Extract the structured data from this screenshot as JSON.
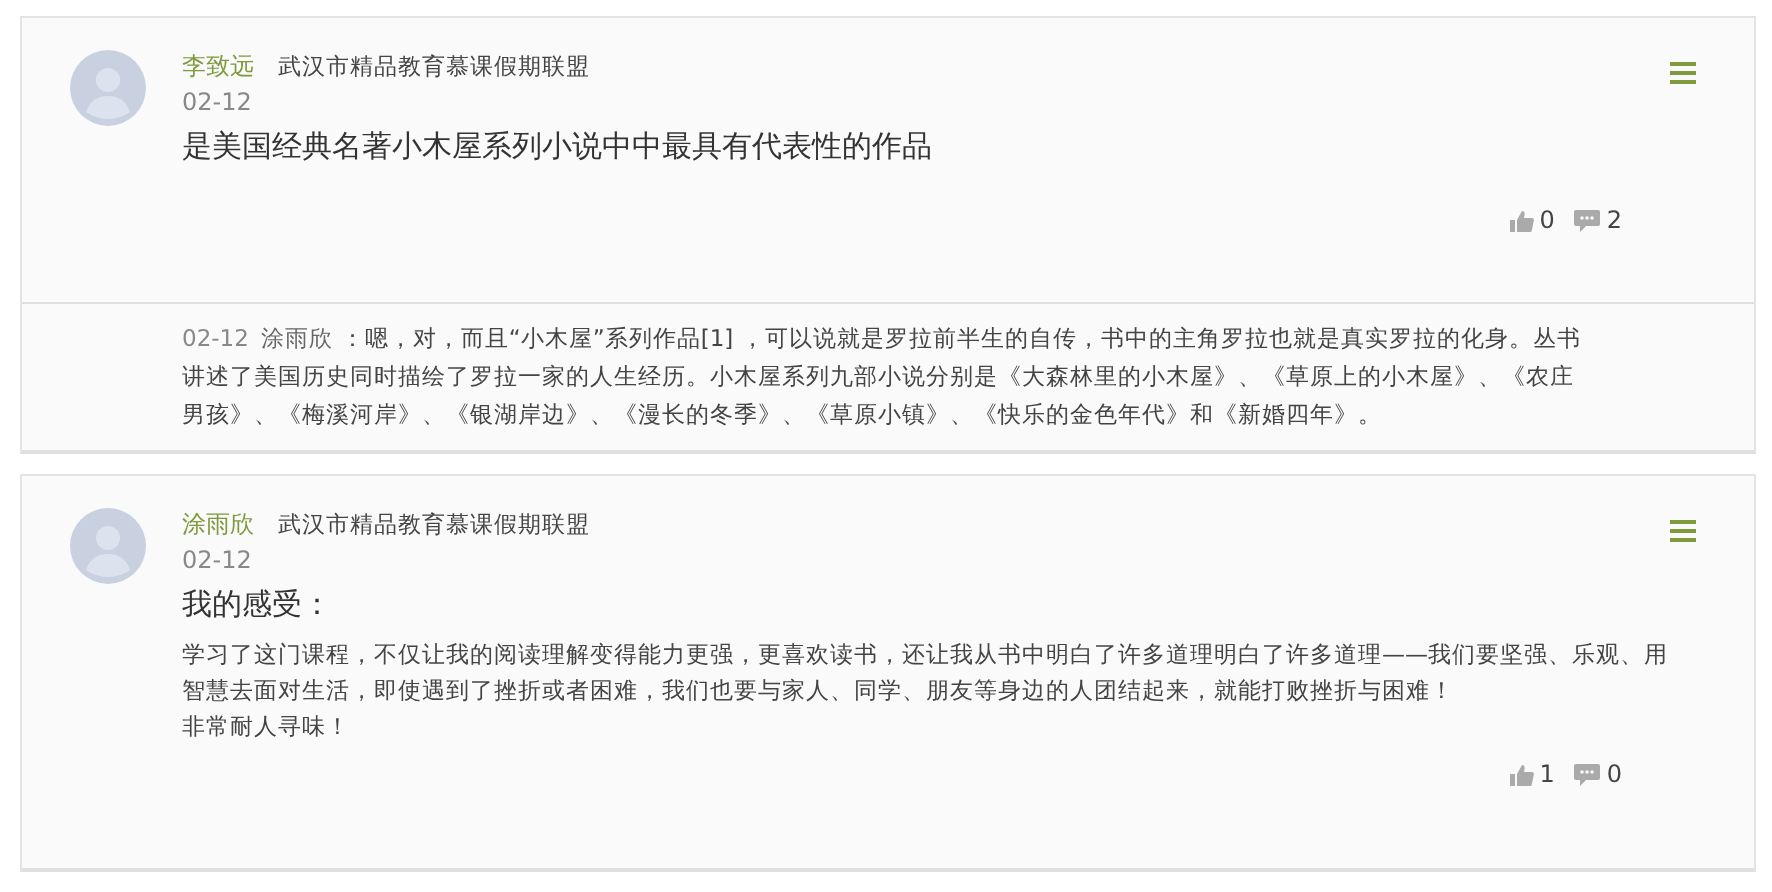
{
  "posts": [
    {
      "author": "李致远",
      "group": "武汉市精品教育慕课假期联盟",
      "date": "02-12",
      "title": "是美国经典名著小木屋系列小说中中最具有代表性的作品",
      "likes": "0",
      "comments": "2",
      "replies": [
        {
          "date": "02-12",
          "author": "涂雨欣",
          "text": "：嗯，对，而且“小木屋”系列作品[1] ，可以说就是罗拉前半生的自传，书中的主角罗拉也就是真实罗拉的化身。丛书讲述了美国历史同时描绘了罗拉一家的人生经历。小木屋系列九部小说分别是《大森林里的小木屋》、《草原上的小木屋》、《农庄男孩》、《梅溪河岸》、《银湖岸边》、《漫长的冬季》、《草原小镇》、《快乐的金色年代》和《新婚四年》。"
        }
      ]
    },
    {
      "author": "涂雨欣",
      "group": "武汉市精品教育慕课假期联盟",
      "date": "02-12",
      "title": "我的感受：",
      "paragraphs": [
        "学习了这门课程，不仅让我的阅读理解变得能力更强，更喜欢读书，还让我从书中明白了许多道理明白了许多道理——我们要坚强、乐观、用智慧去面对生活，即使遇到了挫折或者困难，我们也要与家人、同学、朋友等身边的人团结起来，就能打败挫折与困难！",
        "非常耐人寻味！"
      ],
      "likes": "1",
      "comments": "0"
    }
  ]
}
